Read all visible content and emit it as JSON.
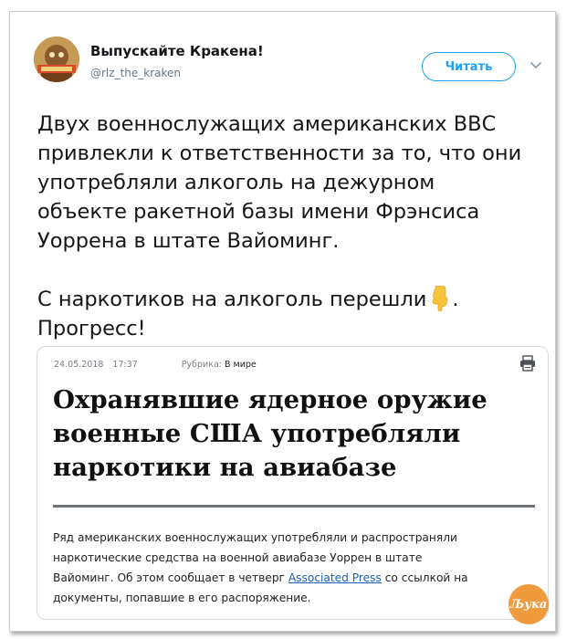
{
  "tweet": {
    "author_name": "Выпускайте Кракена!",
    "author_handle": "@rlz_the_kraken",
    "follow_label": "Читать",
    "text_lines_p1": [
      "Двух военнослужащих американских ВВС",
      "привлекли к ответственности за то, что они",
      "употребляли алкоголь на дежурном",
      "объекте ракетной базы имени Фрэнсиса",
      "Уоррена в штате Вайоминг."
    ],
    "text_p2_line1_start": "С наркотиков на алкоголь перешли",
    "text_p2_line1_end": ".",
    "text_p2_line2": "Прогресс!",
    "emoji": "backhand-index-pointing-down"
  },
  "card": {
    "date": "24.05.2018",
    "time": "17:37",
    "rubric_label": "Рубрика:",
    "rubric_value": "В мире",
    "headline_lines": [
      "Охранявшие ядерное оружие",
      "военные США употребляли",
      "наркотики на авиабазе"
    ],
    "body_line1": "Ряд американских военнослужащих употребляли и распространяли",
    "body_line2": "наркотические средства на военной авиабазе Уоррен в штате",
    "body_line3_start": "Вайоминг. Об этом сообщает в четверг",
    "body_link": "Associated Press",
    "body_line3_end": "со ссылкой на",
    "body_line4": "документы, попавшие в его распоряжение."
  },
  "watermark": {
    "text": "Љука"
  },
  "colors": {
    "accent": "#1da1f2",
    "link": "#1a5fb4",
    "rule": "#6b7078",
    "watermark": "#f09a3e"
  }
}
